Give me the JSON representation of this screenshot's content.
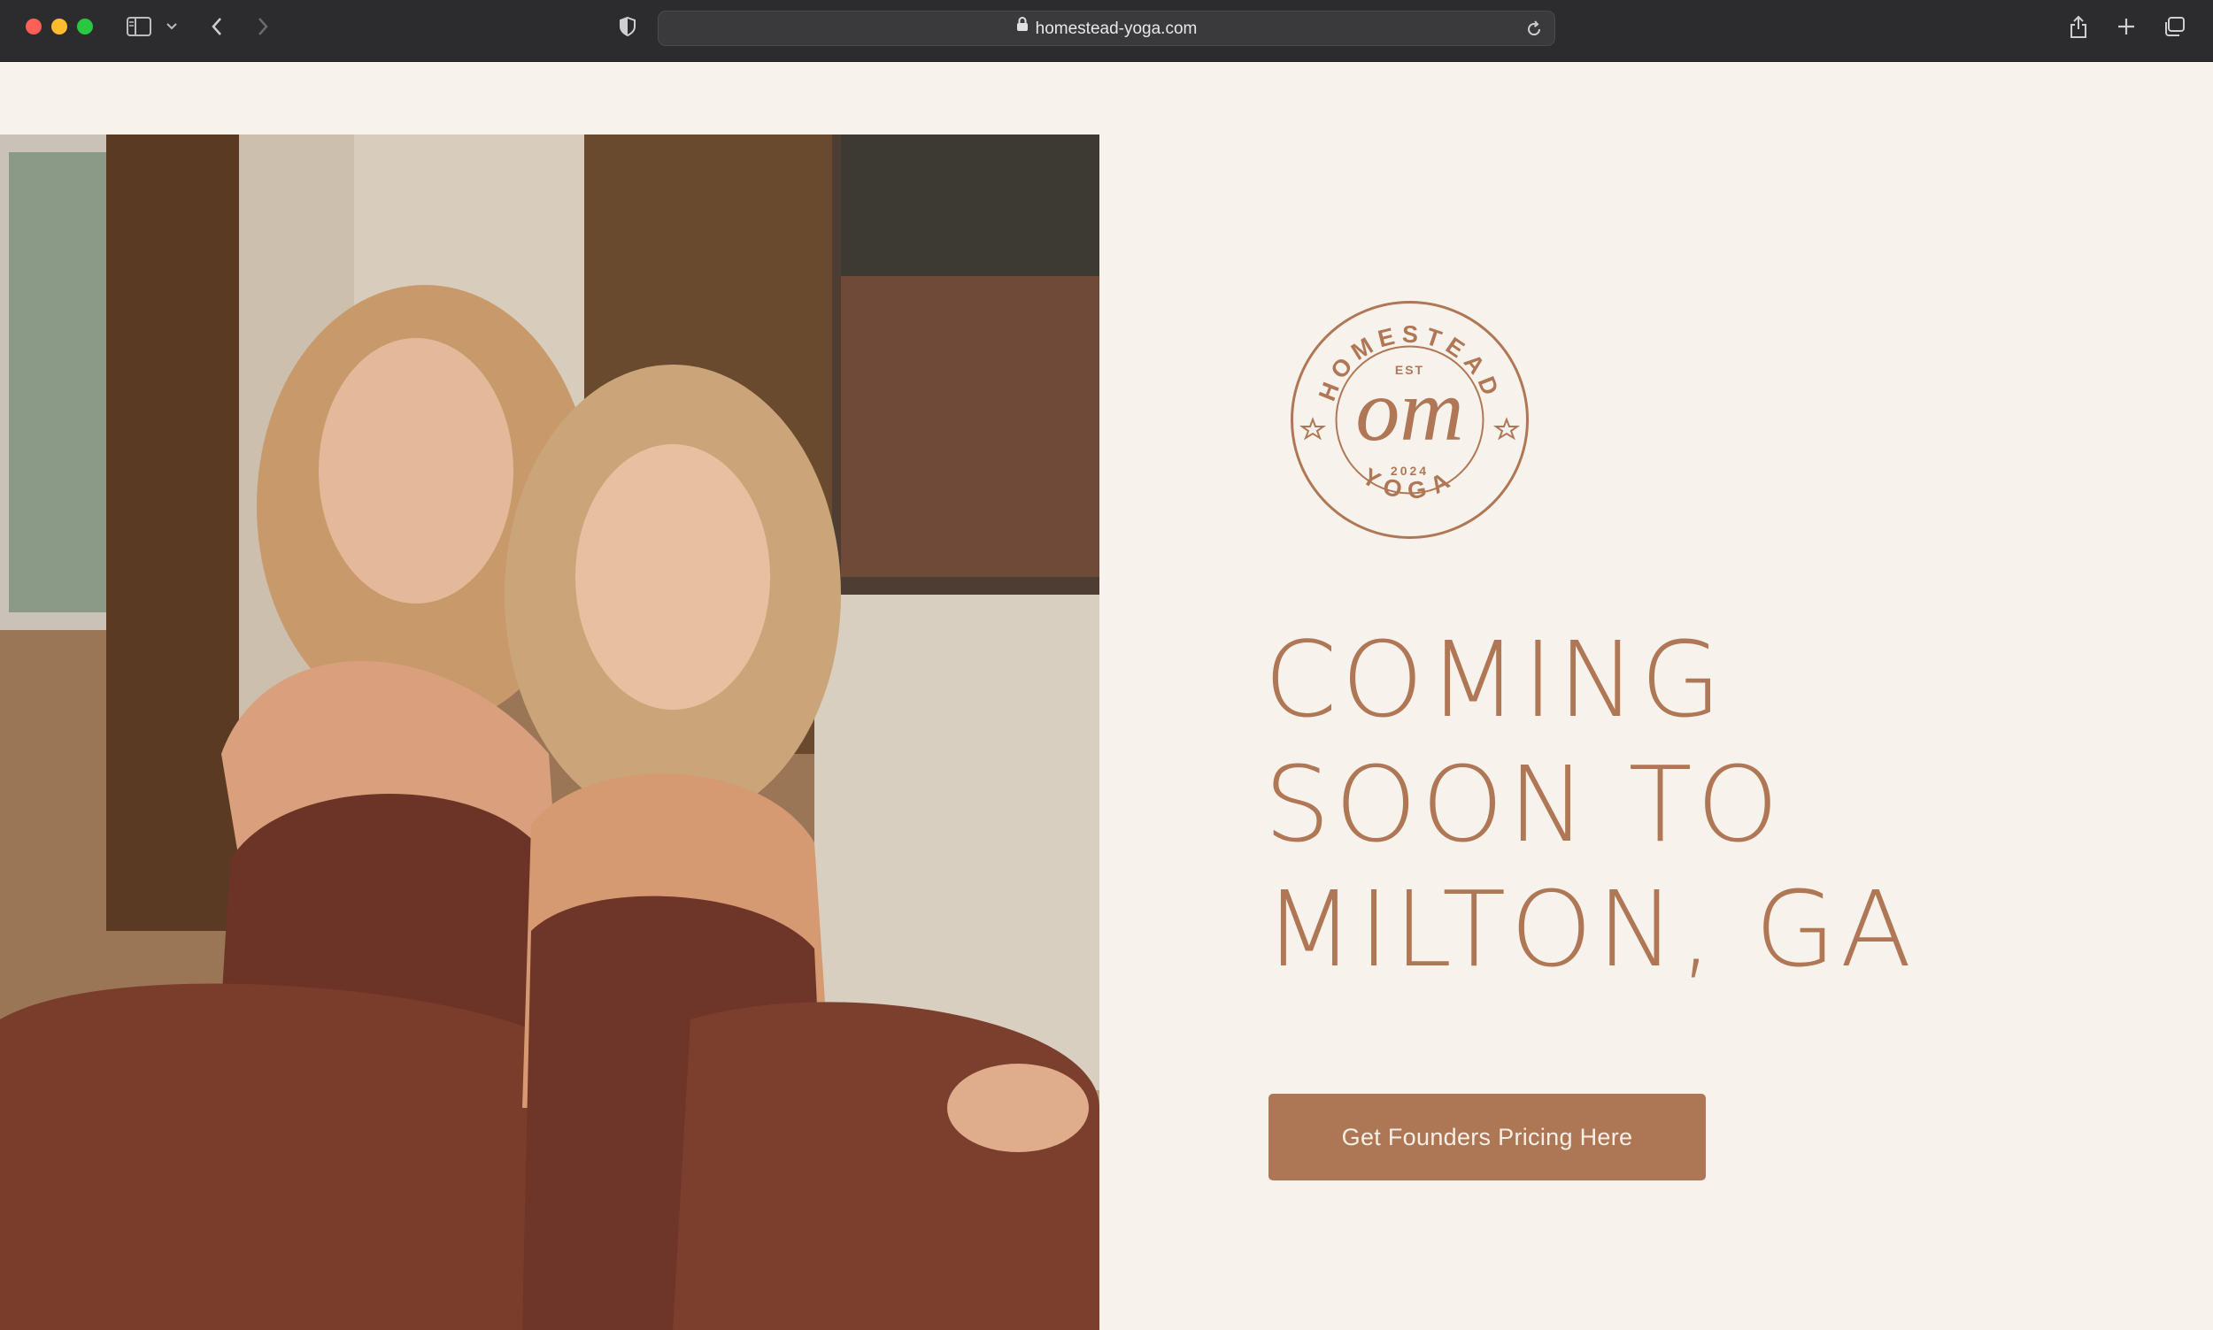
{
  "browser": {
    "url": "homestead-yoga.com"
  },
  "logo": {
    "arc_top": "HOMESTEAD",
    "est": "EST",
    "monogram": "om",
    "year": "2024",
    "arc_bottom": "YOGA"
  },
  "hero": {
    "headline_lines": [
      "COMING",
      "SOON TO",
      "MILTON, GA"
    ],
    "cta_label": "Get Founders Pricing Here"
  },
  "colors": {
    "background": "#f7f3ec",
    "accent": "#b07756",
    "button": "#ad7654",
    "button_text": "#f7efe6"
  },
  "icons": [
    "sidebar-icon",
    "chevron-down-icon",
    "back-icon",
    "forward-icon",
    "shield-icon",
    "lock-icon",
    "reload-icon",
    "share-icon",
    "plus-icon",
    "tabs-icon"
  ]
}
